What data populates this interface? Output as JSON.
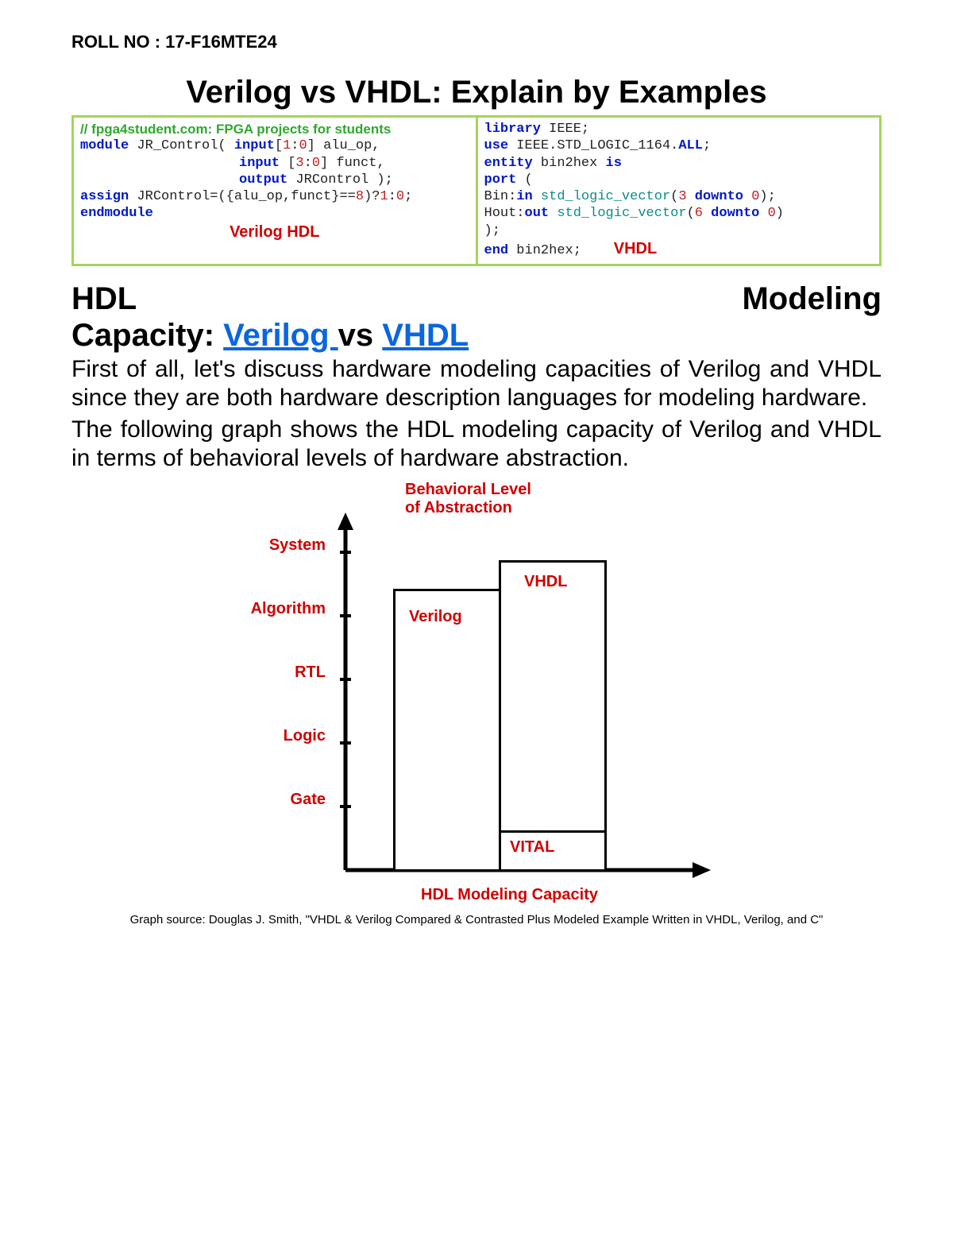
{
  "roll": "ROLL NO : 17-F16MTE24",
  "title": "Verilog vs VHDL: Explain by Examples",
  "codePanel": {
    "left": {
      "comment": "// fpga4student.com: FPGA projects for students",
      "l1a": "module",
      "l1b": " JR_Control( ",
      "l1c": "input",
      "l1d": "[",
      "l1e": "1",
      "l1f": ":",
      "l1g": "0",
      "l1h": "] alu_op,",
      "l2a": "input",
      "l2b": " [",
      "l2c": "3",
      "l2d": ":",
      "l2e": "0",
      "l2f": "] funct,",
      "l3a": "output",
      "l3b": " JRControl );",
      "l4a": "assign",
      "l4b": " JRControl=({alu_op,funct}==",
      "l4c": "8",
      "l4d": ")?",
      "l4e": "1",
      "l4f": ":",
      "l4g": "0",
      "l4h": ";",
      "l5": "endmodule",
      "label": "Verilog HDL"
    },
    "right": {
      "l1a": "library",
      "l1b": " IEEE;",
      "l2a": "use",
      "l2b": " IEEE.STD_LOGIC_1164.",
      "l2c": "ALL",
      "l2d": ";",
      "l3a": "entity",
      "l3b": " bin2hex ",
      "l3c": "is",
      "l4a": "port",
      "l4b": " (",
      "l5a": "Bin:",
      "l5b": "in",
      "l5c": " std_logic_vector",
      "l5d": "(",
      "l5e": "3",
      "l5f": " downto ",
      "l5g": "0",
      "l5h": ");",
      "l6a": "Hout:",
      "l6b": "out",
      "l6c": " std_logic_vector",
      "l6d": "(",
      "l6e": "6",
      "l6f": " downto ",
      "l6g": "0",
      "l6h": ")",
      "l7": ");",
      "l8a": "end",
      "l8b": " bin2hex;",
      "label": "VHDL"
    }
  },
  "h2": {
    "a": "HDL",
    "b": "Modeling",
    "c": "Capacity: ",
    "linkVerilog": "Verilog ",
    "vs": "vs ",
    "linkVHDL": "VHDL"
  },
  "para1": "First of all, let's discuss hardware modeling capacities of Verilog and VHDL since they are both hardware description languages for modeling hardware.",
  "para2": "The following graph shows the HDL modeling capacity of Verilog and VHDL in terms of behavioral levels of hardware abstraction.",
  "diagram": {
    "axisTitle1": "Behavioral Level",
    "axisTitle2": "of Abstraction",
    "levels": [
      "System",
      "Algorithm",
      "RTL",
      "Logic",
      "Gate"
    ],
    "bar1": "Verilog",
    "bar2": "VHDL",
    "bar3": "VITAL",
    "xTitle": "HDL Modeling Capacity"
  },
  "source": "Graph source: Douglas J. Smith, \"VHDL & Verilog Compared & Contrasted Plus Modeled Example Written in VHDL, Verilog, and C\"",
  "chart_data": {
    "type": "bar",
    "title": "HDL Modeling Capacity",
    "xlabel": "HDL Modeling Capacity",
    "ylabel": "Behavioral Level of Abstraction",
    "y_categories_top_to_bottom": [
      "System",
      "Algorithm",
      "RTL",
      "Logic",
      "Gate"
    ],
    "series": [
      {
        "name": "Verilog",
        "span": [
          "Algorithm",
          "Gate"
        ]
      },
      {
        "name": "VHDL",
        "span": [
          "System",
          "Gate"
        ]
      },
      {
        "name": "VITAL",
        "span": [
          "Gate",
          "Gate"
        ]
      }
    ]
  }
}
